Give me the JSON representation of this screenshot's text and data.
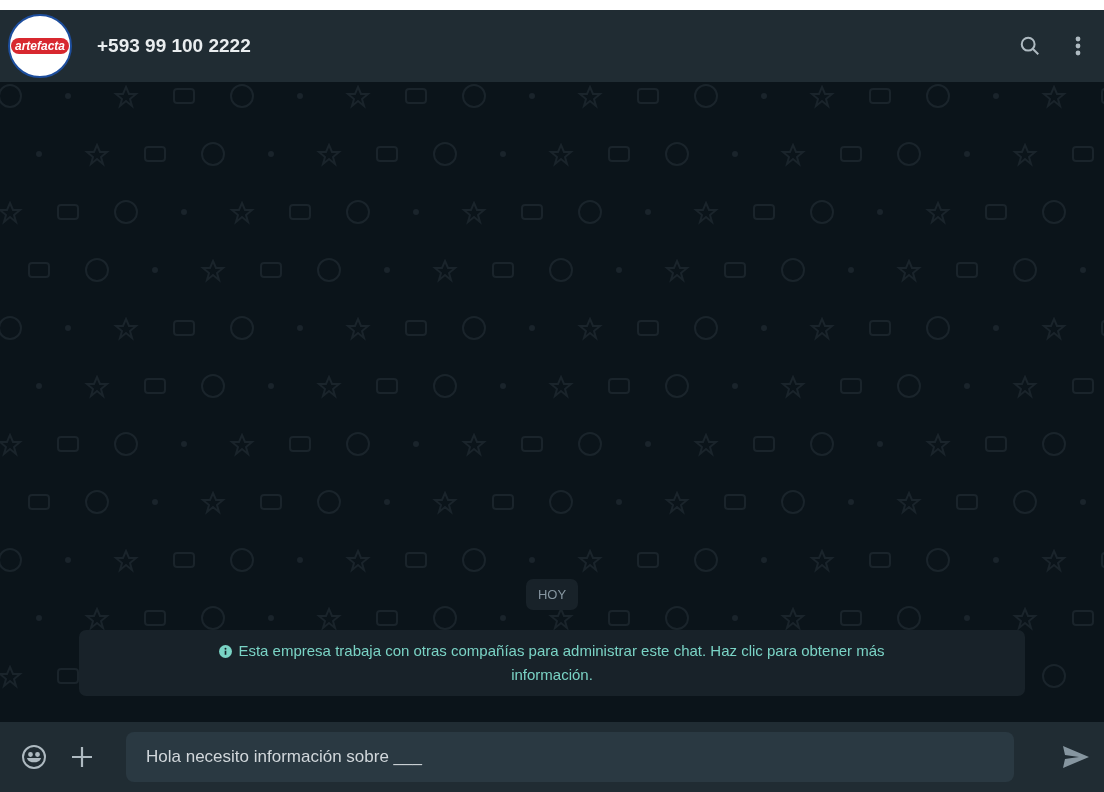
{
  "header": {
    "logo_text": "artefacta",
    "title": "+593 99 100 2222"
  },
  "chat": {
    "date_badge": "HOY",
    "notice": "Esta empresa trabaja con otras compañías para administrar este chat. Haz clic para obtener más información."
  },
  "composer": {
    "value": "Hola necesito información sobre ___"
  }
}
